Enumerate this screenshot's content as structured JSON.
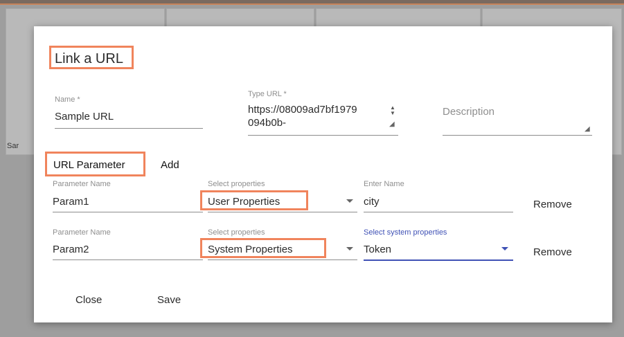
{
  "background": {
    "card_label": "Sar"
  },
  "dialog": {
    "title": "Link a URL",
    "name_field": {
      "label": "Name *",
      "value": "Sample URL"
    },
    "type_url_field": {
      "label": "Type URL *",
      "value_line1": "https://08009ad7bf1979",
      "value_line2": "094b0b-"
    },
    "description_field": {
      "placeholder": "Description"
    },
    "tabs": {
      "url_parameter": "URL Parameter",
      "add": "Add"
    },
    "parameters": [
      {
        "name_label": "Parameter Name",
        "name_value": "Param1",
        "select_label": "Select properties",
        "select_value": "User Properties",
        "third_label": "Enter Name",
        "third_value": "city",
        "remove": "Remove"
      },
      {
        "name_label": "Parameter Name",
        "name_value": "Param2",
        "select_label": "Select properties",
        "select_value": "System Properties",
        "third_label": "Select system properties",
        "third_value": "Token",
        "remove": "Remove"
      }
    ],
    "actions": {
      "close": "Close",
      "save": "Save"
    }
  },
  "colors": {
    "highlight": "#f0845c",
    "focus": "#3f51b5"
  }
}
